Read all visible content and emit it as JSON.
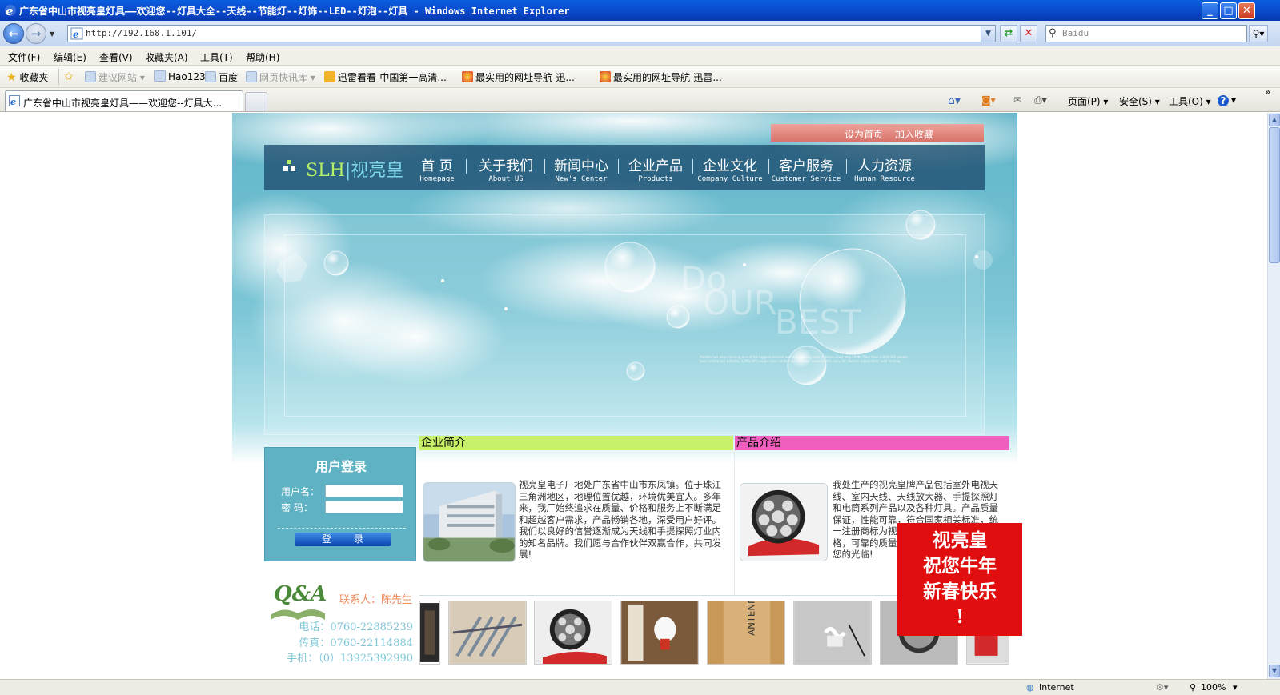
{
  "window": {
    "title": "广东省中山市视亮皇灯具——欢迎您--灯具大全--天线--节能灯--灯饰--LED--灯泡--灯具 - Windows Internet Explorer",
    "min": "_",
    "max": "□",
    "close": "✕"
  },
  "address": {
    "url": "http://192.168.1.101/",
    "search_placeholder": "Baidu"
  },
  "menu": [
    "文件(F)",
    "编辑(E)",
    "查看(V)",
    "收藏夹(A)",
    "工具(T)",
    "帮助(H)"
  ],
  "favorites": {
    "label": "收藏夹",
    "items": [
      "建议网站 ▾",
      "Hao123",
      "百度",
      "网页快讯库 ▾",
      "迅雷看看-中国第一高清...",
      "最实用的网址导航-迅...",
      "最实用的网址导航-迅雷..."
    ]
  },
  "tab": {
    "title": "广东省中山市视亮皇灯具——欢迎您--灯具大..."
  },
  "commandbar": {
    "page": "页面(P) ▾",
    "safety": "安全(S) ▾",
    "tools": "工具(O) ▾",
    "more": "»"
  },
  "status": {
    "zone": "Internet",
    "zoom": "100%"
  },
  "site": {
    "top_links": {
      "set_home": "设为首页",
      "add_fav": "加入收藏"
    },
    "logo": {
      "en": "SLH",
      "bar": "|",
      "cn": "视亮皇"
    },
    "nav": [
      {
        "cn": "首  页",
        "en": "Homepage"
      },
      {
        "cn": "关于我们",
        "en": "About US"
      },
      {
        "cn": "新闻中心",
        "en": "New's Center"
      },
      {
        "cn": "企业产品",
        "en": "Products"
      },
      {
        "cn": "企业文化",
        "en": "Company Culture"
      },
      {
        "cn": "客户服务",
        "en": "Customer Service"
      },
      {
        "cn": "人力资源",
        "en": "Human Resource"
      }
    ],
    "banner": {
      "word1": "Do",
      "word2": "OUR",
      "word3": "BEST",
      "small": "Aladdin has been running one of the biggest domain and web hosting sites in Korea since May 1998. More than 3,000,000 people have visited our website. 3,000,000 people have visited our website: www.aladdin.com, for domain registration, web hosting."
    },
    "login": {
      "title": "用户登录",
      "username_label": "用户名：",
      "password_label": "密  码：",
      "submit": "登录"
    },
    "contact": {
      "person": "联系人：陈先生",
      "phone": "电话：0760-22885239",
      "fax": "传真：0760-22114884",
      "mobile": "手机：（0）13925392990"
    },
    "company": {
      "heading": "企业简介",
      "text": "视亮皇电子厂地处广东省中山市东凤镇。位于珠江三角洲地区，地理位置优越，环境优美宜人。多年来，我厂始终追求在质量、价格和服务上不断满足和超越客户需求，产品畅销各地，深受用户好评。我们以良好的信誉逐渐成为天线和手提探照灯业内的知名品牌。我们愿与合作伙伴双赢合作，共同发展!"
    },
    "products": {
      "heading": "产品介绍",
      "text": "我处生产的视亮皇牌产品包括室外电视天线、室内天线、天线放大器、手提探照灯和电筒系列产品以及各种灯具。产品质量保证，性能可靠，符合国家相关标准，统一注册商标为视亮皇。我们以优惠的价格，可靠的质量，优质的服务，热忱欢迎您的光临!"
    },
    "popup": {
      "line1": "视亮皇",
      "line2": "祝您牛年",
      "line3": "新春快乐",
      "line4": "!"
    }
  },
  "colors": {
    "ie_titlebar": "#0a48c8",
    "nav_bg": "#1c4c6e",
    "company_header": "#c8f06a",
    "product_header": "#ef5fbf",
    "popup_red": "#e00e0e"
  }
}
